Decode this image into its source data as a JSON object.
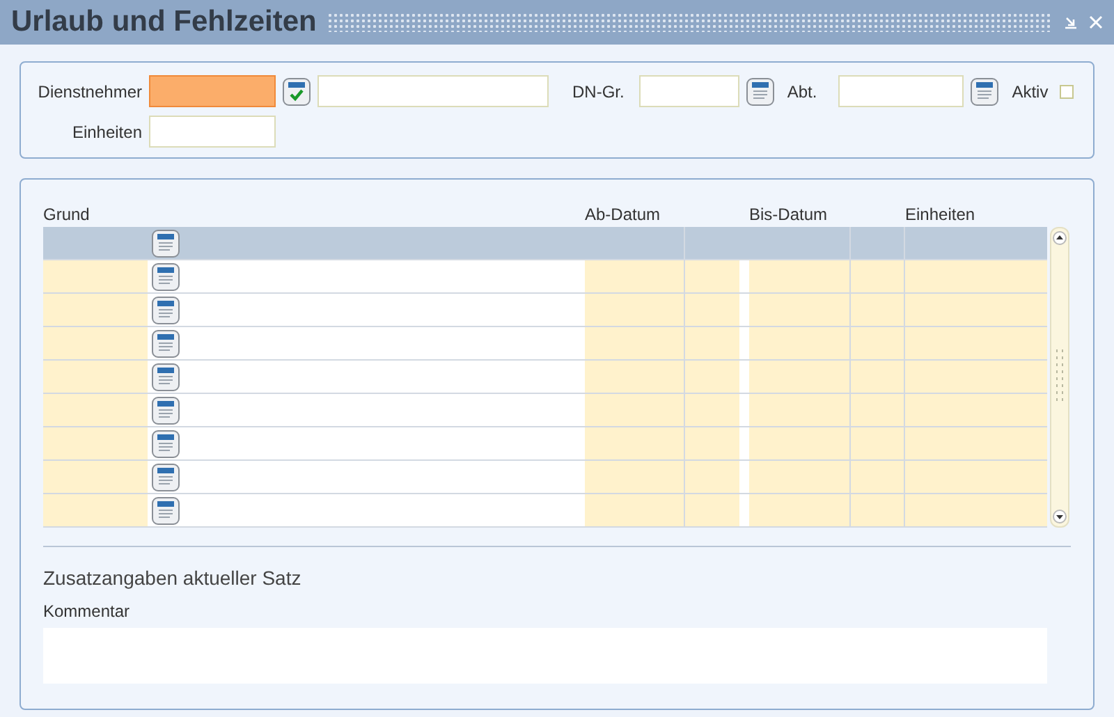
{
  "window": {
    "title": "Urlaub und Fehlzeiten"
  },
  "filter": {
    "employee_label": "Dienstnehmer",
    "employee_focused": true,
    "units_label": "Einheiten",
    "group_label": "DN-Gr.",
    "department_label": "Abt.",
    "active_label": "Aktiv",
    "active_checked": false
  },
  "table": {
    "columns": [
      "Grund",
      "Ab-Datum",
      "Bis-Datum",
      "Einheiten"
    ],
    "rows": [
      {
        "selected": true
      },
      {
        "selected": false
      },
      {
        "selected": false
      },
      {
        "selected": false
      },
      {
        "selected": false
      },
      {
        "selected": false
      },
      {
        "selected": false
      },
      {
        "selected": false
      },
      {
        "selected": false
      }
    ]
  },
  "details": {
    "heading": "Zusatzangaben aktueller Satz",
    "comment_label": "Kommentar"
  }
}
